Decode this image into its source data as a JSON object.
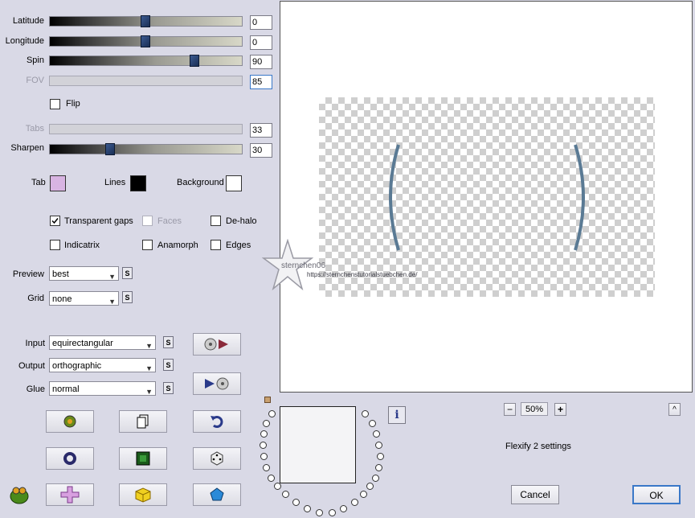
{
  "sliders": [
    {
      "label": "Latitude",
      "value": "0",
      "enabled": true,
      "level": 0.5
    },
    {
      "label": "Longitude",
      "value": "0",
      "enabled": true,
      "level": 0.5
    },
    {
      "label": "Spin",
      "value": "90",
      "enabled": true,
      "level": 0.75
    },
    {
      "label": "FOV",
      "value": "85",
      "enabled": false
    },
    {
      "label": "Tabs",
      "value": "33",
      "enabled": false
    },
    {
      "label": "Sharpen",
      "value": "30",
      "enabled": true,
      "level": 0.3
    }
  ],
  "flip": {
    "label": "Flip",
    "checked": false
  },
  "colors": {
    "tab": {
      "label": "Tab",
      "color": "#d8b4e2"
    },
    "lines": {
      "label": "Lines",
      "color": "#000000"
    },
    "background": {
      "label": "Background",
      "color": "#ffffff"
    }
  },
  "options": {
    "transparent_gaps": {
      "label": "Transparent gaps",
      "checked": true
    },
    "faces": {
      "label": "Faces",
      "checked": false,
      "enabled": false
    },
    "de_halo": {
      "label": "De-halo",
      "checked": false
    },
    "indicatrix": {
      "label": "Indicatrix",
      "checked": false
    },
    "anamorph": {
      "label": "Anamorph",
      "checked": false
    },
    "edges": {
      "label": "Edges",
      "checked": false
    }
  },
  "dropdowns": {
    "preview": {
      "label": "Preview",
      "value": "best"
    },
    "grid": {
      "label": "Grid",
      "value": "none"
    },
    "input": {
      "label": "Input",
      "value": "equirectangular"
    },
    "output": {
      "label": "Output",
      "value": "orthographic"
    },
    "glue": {
      "label": "Glue",
      "value": "normal"
    }
  },
  "s_label": "S",
  "watermark": {
    "name": "sternchen06",
    "url": "https://sternchenstutorialstuebchen.de/"
  },
  "zoom": {
    "minus": "−",
    "value": "50%",
    "plus": "+"
  },
  "collapse_label": "^",
  "info_label": "i",
  "settings_name": "Flexify 2 settings",
  "buttons": {
    "cancel": "Cancel",
    "ok": "OK"
  },
  "icons": [
    "globe-play-icon",
    "play-globe-icon",
    "frog-settings-icon",
    "copy-icon",
    "undo-icon",
    "ring-icon",
    "frame-icon",
    "dice-icon",
    "cross-icon",
    "cube-icon",
    "pentagon-icon",
    "frog-logo-icon"
  ]
}
